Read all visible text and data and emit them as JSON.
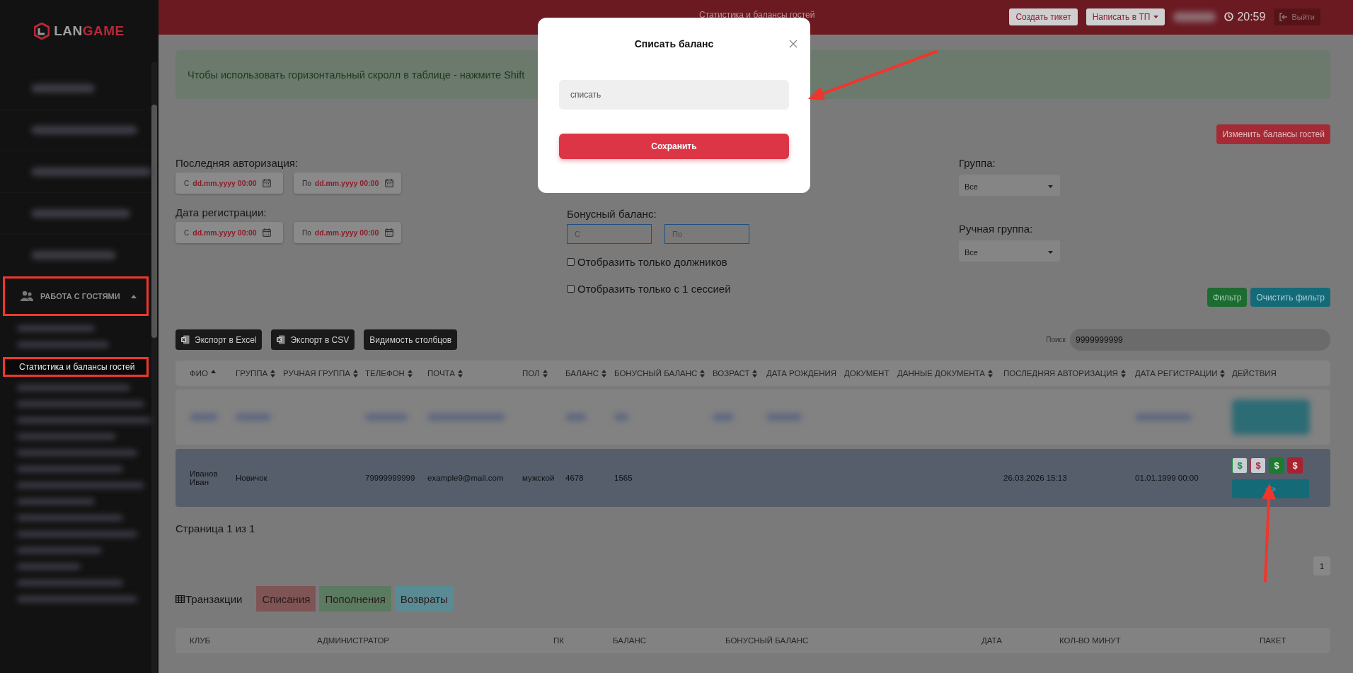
{
  "sidebar": {
    "logo": {
      "part_1": "LAN",
      "part_2": "GAME"
    },
    "items": [
      {
        "kind": "blurred"
      },
      {
        "kind": "blurred"
      },
      {
        "kind": "blurred"
      },
      {
        "kind": "blurred"
      },
      {
        "kind": "blurred"
      },
      {
        "kind": "section",
        "label": "РАБОТА С ГОСТЯМИ",
        "expanded": true,
        "highlighted": true,
        "children": [
          {
            "kind": "blurred"
          },
          {
            "kind": "blurred"
          },
          {
            "kind": "link",
            "label": "Статистика и балансы гостей",
            "selected": true,
            "highlighted": true
          },
          {
            "kind": "blurred"
          },
          {
            "kind": "blurred"
          },
          {
            "kind": "blurred"
          },
          {
            "kind": "blurred"
          },
          {
            "kind": "blurred"
          },
          {
            "kind": "blurred"
          },
          {
            "kind": "blurred"
          },
          {
            "kind": "blurred"
          },
          {
            "kind": "blurred"
          },
          {
            "kind": "blurred"
          },
          {
            "kind": "blurred"
          },
          {
            "kind": "blurred"
          },
          {
            "kind": "blurred"
          },
          {
            "kind": "blurred"
          }
        ]
      }
    ]
  },
  "topbar": {
    "title": "Статистика и балансы гостей",
    "buttons": [
      {
        "label": "Создать тикет",
        "kind": "plain"
      },
      {
        "label": "Написать в ТП",
        "kind": "dropdown"
      }
    ],
    "time": "20:59",
    "logout": "Выйти"
  },
  "alert": "Чтобы использовать горизонтальный скролл в таблице - нажмите Shift",
  "change_balances_button": "Изменить балансы гостей",
  "filters": {
    "last_authorization": {
      "label": "Последняя авторизация:",
      "from": {
        "prefix": "С",
        "placeholder": "dd.mm.yyyy 00:00"
      },
      "to": {
        "prefix": "По",
        "placeholder": "dd.mm.yyyy 00:00"
      }
    },
    "registration_date": {
      "label": "Дата регистрации:",
      "from": {
        "prefix": "С",
        "placeholder": "dd.mm.yyyy 00:00"
      },
      "to": {
        "prefix": "По",
        "placeholder": "dd.mm.yyyy 00:00"
      }
    },
    "bonus_balance": {
      "label": "Бонусный баланс:",
      "from": {
        "placeholder": "С"
      },
      "to": {
        "placeholder": "По"
      }
    },
    "checkboxes": [
      {
        "label": "Отобразить только должников",
        "checked": false
      },
      {
        "label": "Отобразить только с 1 сессией",
        "checked": false
      }
    ],
    "group": {
      "label": "Группа:",
      "value": "Все"
    },
    "manual_group": {
      "label": "Ручная группа:",
      "value": "Все"
    },
    "buttons": [
      {
        "label": "Фильтр",
        "kind": "apply"
      },
      {
        "label": "Очистить фильтр",
        "kind": "clear"
      }
    ]
  },
  "export_buttons": [
    {
      "label": "Экспорт в Excel",
      "kind": "file"
    },
    {
      "label": "Экспорт в CSV",
      "kind": "file"
    },
    {
      "label": "Видимость столбцов",
      "kind": "plain"
    }
  ],
  "search": {
    "label": "Поиск",
    "value": "9999999999"
  },
  "table": {
    "columns": [
      {
        "label": "ФИО",
        "sortable": true,
        "sorted": true
      },
      {
        "label": "ГРУППА",
        "sortable": true,
        "sorted": false
      },
      {
        "label": "РУЧНАЯ ГРУППА",
        "sortable": true,
        "sorted": false
      },
      {
        "label": "ТЕЛЕФОН",
        "sortable": true,
        "sorted": false
      },
      {
        "label": "ПОЧТА",
        "sortable": true,
        "sorted": false
      },
      {
        "label": "ПОЛ",
        "sortable": true,
        "sorted": false
      },
      {
        "label": "БАЛАНС",
        "sortable": true,
        "sorted": false
      },
      {
        "label": "БОНУСНЫЙ БАЛАНС",
        "sortable": true,
        "sorted": false
      },
      {
        "label": "ВОЗРАСТ",
        "sortable": true,
        "sorted": false
      },
      {
        "label": "ДАТА РОЖДЕНИЯ",
        "sortable": false
      },
      {
        "label": "ДОКУМЕНТ",
        "sortable": false
      },
      {
        "label": "ДАННЫЕ ДОКУМЕНТА",
        "sortable": true,
        "sorted": false
      },
      {
        "label": "ПОСЛЕДНЯЯ АВТОРИЗАЦИЯ",
        "sortable": true,
        "sorted": false
      },
      {
        "label": "ДАТА РЕГИСТРАЦИИ",
        "sortable": true,
        "sorted": false
      },
      {
        "label": "ДЕЙСТВИЯ",
        "sortable": false
      }
    ],
    "rows": [
      {
        "kind": "blurred",
        "selected": false
      },
      {
        "kind": "data",
        "selected": true,
        "cells": [
          "Иванов Иван",
          "Новичок",
          null,
          "79999999999",
          "example9@mail.com",
          "мужской",
          "4678",
          "1565",
          null,
          null,
          null,
          null,
          "26.03.2026 15:13",
          "01.01.1999 00:00"
        ],
        "actions": [
          {
            "label": "$",
            "kind": "outline",
            "color": "#1d8a3a"
          },
          {
            "label": "$",
            "kind": "outline",
            "color": "#b8283a"
          },
          {
            "label": "$",
            "kind": "solid",
            "color": "#1d7a30"
          },
          {
            "label": "$",
            "kind": "solid",
            "color": "#a8222f"
          }
        ]
      }
    ]
  },
  "page_info": "Страница 1 из 1",
  "pagination": [
    {
      "label": "1",
      "selected": true
    }
  ],
  "transactions": {
    "title": "Транзакции",
    "tabs": [
      {
        "label": "Списания",
        "color": "#7f5454"
      },
      {
        "label": "Пополнения",
        "color": "#5a7b5f"
      },
      {
        "label": "Возвраты",
        "color": "#5a8a93"
      }
    ],
    "columns": [
      "КЛУБ",
      "АДМИНИСТРАТОР",
      "ПК",
      "БАЛАНС",
      "БОНУСНЫЙ БАЛАНС",
      "ДАТА",
      "КОЛ-ВО МИНУТ",
      "ПАКЕТ"
    ]
  },
  "modal": {
    "title": "Списать баланс",
    "field": {
      "placeholder": "списать"
    },
    "button": "Сохранить"
  },
  "annotations": [
    {
      "kind": "arrow"
    },
    {
      "kind": "arrow"
    }
  ]
}
